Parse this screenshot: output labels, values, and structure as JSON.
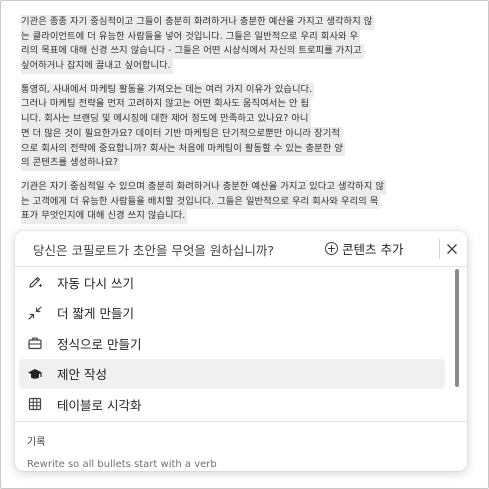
{
  "document": {
    "paragraphs": [
      {
        "lines": [
          "기관은 종종 자기 중심적이고 그들이 충분히 화려하거나 충분한 예산을 가지고 생각하지 않",
          "는 클라이언트에 더 유능한 사람들을 넣어 것입니다. 그들은 일반적으로 우리 회사와 우",
          "리의 목표에 대해 신경 쓰지 않습니다 - 그들은 어떤 시상식에서 자신의 트로피를 가지고",
          "싶어하거나 잡지에 끌내고 싶어합니다."
        ]
      },
      {
        "lines": [
          "통영히, 사내에서 마케팅 활동을 가져오는 데는 여러 가지 이유가 있습니다.",
          "그러나 마케팅 전략을 먼저 고려하지 않고는 어떤 회사도 움직여서는 안 됩",
          "니다. 회사는 브랜딩 및 메시징에 대한 제어 정도에 만족하고 있나요? 아니",
          "면 더 많은 것이 필요한가요? 데이터 기반 마케팅은 단기적으로뿐만 아니라 장기적",
          "으로 회사의 전략에 중요합니까? 회사는 처음에 마케팅이 활동할 수 있는 충분한 양",
          "의 콘텐츠를 생성하나요?"
        ]
      },
      {
        "lines": [
          "기관은 자기 중심적일 수 있으며 충분히 화려하거나 충분한 예산을 가지고 있다고 생각하지 않",
          "는 고객에게 더 유능한 사람들을 배치할 것입니다. 그들은 일반적으로 우리 회사와 우리의 목",
          "표가 무엇인지에 대해 신경 쓰지 않습니다."
        ]
      }
    ]
  },
  "copilot": {
    "prompt": "당신은 코필로트가 초안을 무엇을 원하십니까?",
    "add_content_label": "콘텐츠 추가",
    "menu_items": [
      {
        "label": "자동 다시 쓰기",
        "icon": "pen-sparkle-icon"
      },
      {
        "label": "더 짧게 만들기",
        "icon": "shrink-arrows-icon"
      },
      {
        "label": "정식으로 만들기",
        "icon": "briefcase-icon"
      },
      {
        "label": "제안 작성",
        "icon": "graduation-cap-icon"
      },
      {
        "label": "테이블로 시각화",
        "icon": "table-icon"
      }
    ],
    "history_label": "기록",
    "history_items": [
      "Rewrite so all bullets start with a verb"
    ]
  }
}
